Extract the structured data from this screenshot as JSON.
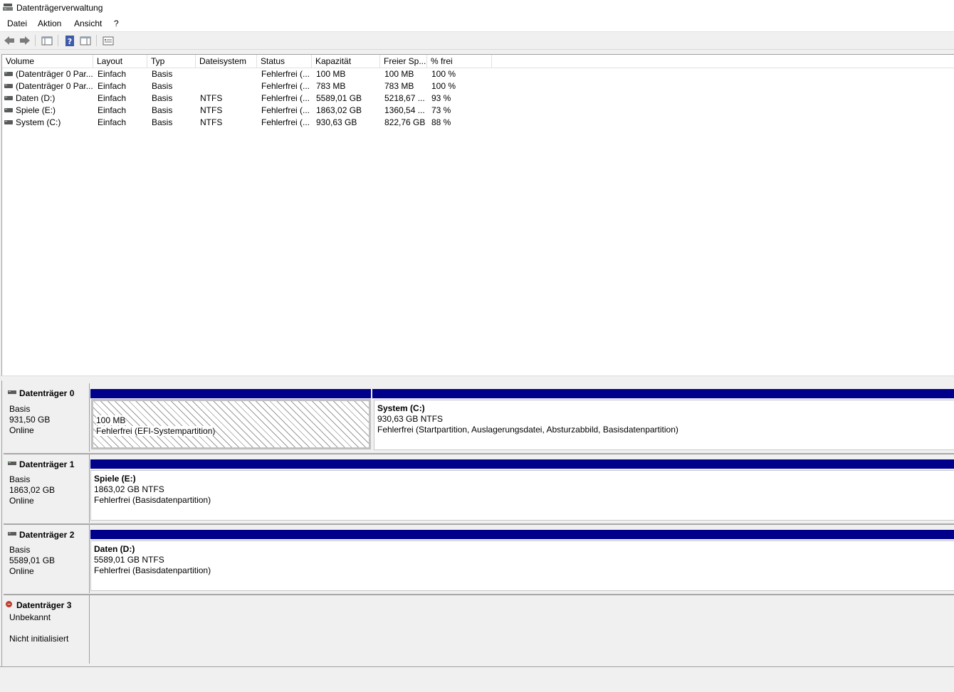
{
  "window": {
    "title": "Datenträgerverwaltung"
  },
  "menu": [
    "Datei",
    "Aktion",
    "Ansicht",
    "?"
  ],
  "toolbar": {
    "icons": [
      "back-icon",
      "forward-icon",
      "console-tree-icon",
      "help-icon",
      "properties-icon",
      "settings-icon"
    ]
  },
  "columns": [
    "Volume",
    "Layout",
    "Typ",
    "Dateisystem",
    "Status",
    "Kapazität",
    "Freier Sp...",
    "% frei"
  ],
  "volumes": [
    {
      "volume": "(Datenträger 0 Par...",
      "layout": "Einfach",
      "typ": "Basis",
      "fs": "",
      "status": "Fehlerfrei (...",
      "cap": "100 MB",
      "free": "100 MB",
      "pct": "100 %"
    },
    {
      "volume": "(Datenträger 0 Par...",
      "layout": "Einfach",
      "typ": "Basis",
      "fs": "",
      "status": "Fehlerfrei (...",
      "cap": "783 MB",
      "free": "783 MB",
      "pct": "100 %"
    },
    {
      "volume": "Daten (D:)",
      "layout": "Einfach",
      "typ": "Basis",
      "fs": "NTFS",
      "status": "Fehlerfrei (...",
      "cap": "5589,01 GB",
      "free": "5218,67 ...",
      "pct": "93 %"
    },
    {
      "volume": "Spiele (E:)",
      "layout": "Einfach",
      "typ": "Basis",
      "fs": "NTFS",
      "status": "Fehlerfrei (...",
      "cap": "1863,02 GB",
      "free": "1360,54 ...",
      "pct": "73 %"
    },
    {
      "volume": "System (C:)",
      "layout": "Einfach",
      "typ": "Basis",
      "fs": "NTFS",
      "status": "Fehlerfrei (...",
      "cap": "930,63 GB",
      "free": "822,76 GB",
      "pct": "88 %"
    }
  ],
  "disks": [
    {
      "name": "Datenträger 0",
      "type": "Basis",
      "size": "931,50 GB",
      "state": "Online",
      "partitions": [
        {
          "title": "",
          "size": "100 MB",
          "status": "Fehlerfrei (EFI-Systempartition)"
        },
        {
          "title": "System  (C:)",
          "size": "930,63 GB NTFS",
          "status": "Fehlerfrei (Startpartition, Auslagerungsdatei, Absturzabbild, Basisdatenpartition)"
        }
      ]
    },
    {
      "name": "Datenträger 1",
      "type": "Basis",
      "size": "1863,02 GB",
      "state": "Online",
      "partitions": [
        {
          "title": "Spiele  (E:)",
          "size": "1863,02 GB NTFS",
          "status": "Fehlerfrei (Basisdatenpartition)"
        }
      ]
    },
    {
      "name": "Datenträger 2",
      "type": "Basis",
      "size": "5589,01 GB",
      "state": "Online",
      "partitions": [
        {
          "title": "Daten  (D:)",
          "size": "5589,01 GB NTFS",
          "status": "Fehlerfrei (Basisdatenpartition)"
        }
      ]
    },
    {
      "name": "Datenträger 3",
      "type": "Unbekannt",
      "state": "Nicht initialisiert"
    }
  ],
  "colors": {
    "partition_bar": "#00008b",
    "background": "#f0f0f0"
  }
}
